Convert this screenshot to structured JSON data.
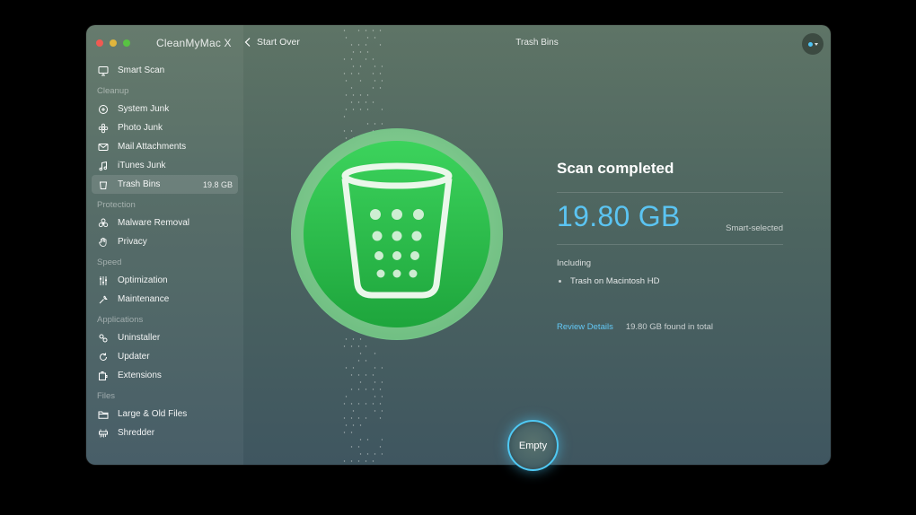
{
  "app": {
    "title": "CleanMyMac X"
  },
  "topbar": {
    "back_label": "Start Over",
    "page_title": "Trash Bins"
  },
  "sidebar": {
    "smart_scan": "Smart Scan",
    "sections": {
      "cleanup": "Cleanup",
      "protection": "Protection",
      "speed": "Speed",
      "applications": "Applications",
      "files": "Files"
    },
    "items": {
      "system_junk": "System Junk",
      "photo_junk": "Photo Junk",
      "mail_attachments": "Mail Attachments",
      "itunes_junk": "iTunes Junk",
      "trash_bins": "Trash Bins",
      "trash_bins_size": "19.8 GB",
      "malware_removal": "Malware Removal",
      "privacy": "Privacy",
      "optimization": "Optimization",
      "maintenance": "Maintenance",
      "uninstaller": "Uninstaller",
      "updater": "Updater",
      "extensions": "Extensions",
      "large_old_files": "Large & Old Files",
      "shredder": "Shredder"
    }
  },
  "result": {
    "title": "Scan completed",
    "size": "19.80 GB",
    "smart_selected": "Smart-selected",
    "including_label": "Including",
    "including_items": [
      "Trash on Macintosh HD"
    ],
    "review_label": "Review Details",
    "found_total": "19.80 GB found in total"
  },
  "actions": {
    "empty_label": "Empty"
  },
  "colors": {
    "accent_blue": "#5bc4f2",
    "icon_green": "#2fbf4a",
    "button_ring": "#4fc9f4",
    "close": "#ef5a52",
    "minimize": "#e0b63c",
    "zoom": "#58c343"
  }
}
